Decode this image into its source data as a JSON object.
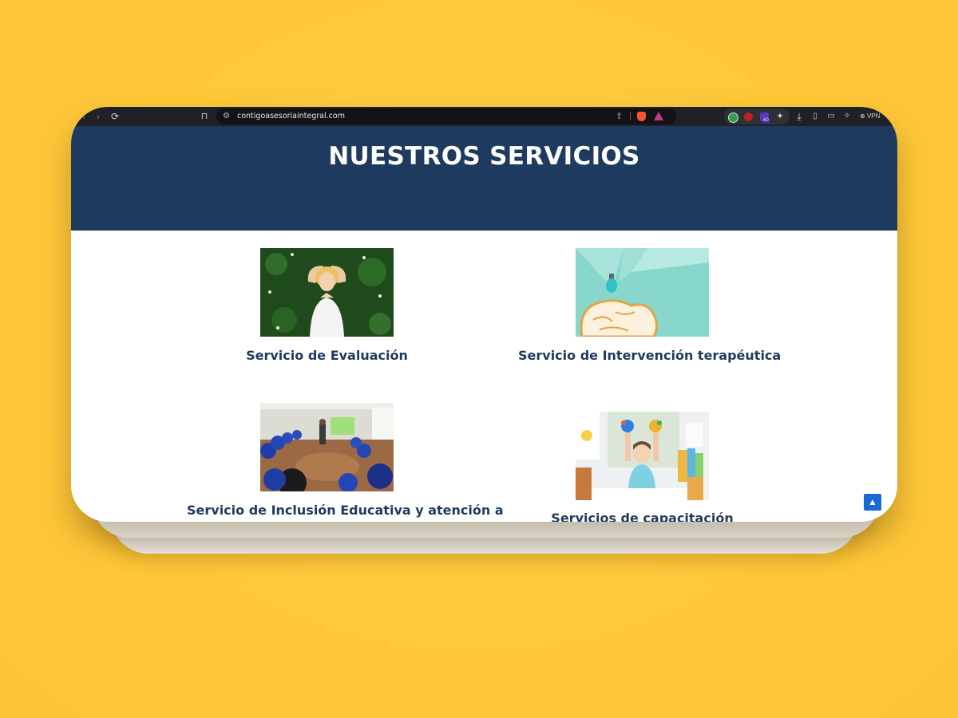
{
  "browser": {
    "url": "contigoasesoriaintegral.com",
    "vpn_label": "VPN",
    "badge_count": "60"
  },
  "hero": {
    "title": "NUESTROS SERVICIOS",
    "background": "#1f3a5f"
  },
  "services": [
    {
      "label": "Servicio de Evaluación",
      "image": "woman-relaxing-on-grass"
    },
    {
      "label": "Servicio de Intervención terapéutica",
      "image": "lightbulb-and-brain"
    },
    {
      "label": "Servicio de Inclusión Educativa y atención a",
      "image": "classroom-circle"
    },
    {
      "label": "Servicios de capacitación",
      "image": "child-painted-hands"
    }
  ],
  "colors": {
    "page_background": "#fec93a",
    "label_color": "#1f3a5f",
    "scroll_top_button": "#1769d3"
  }
}
